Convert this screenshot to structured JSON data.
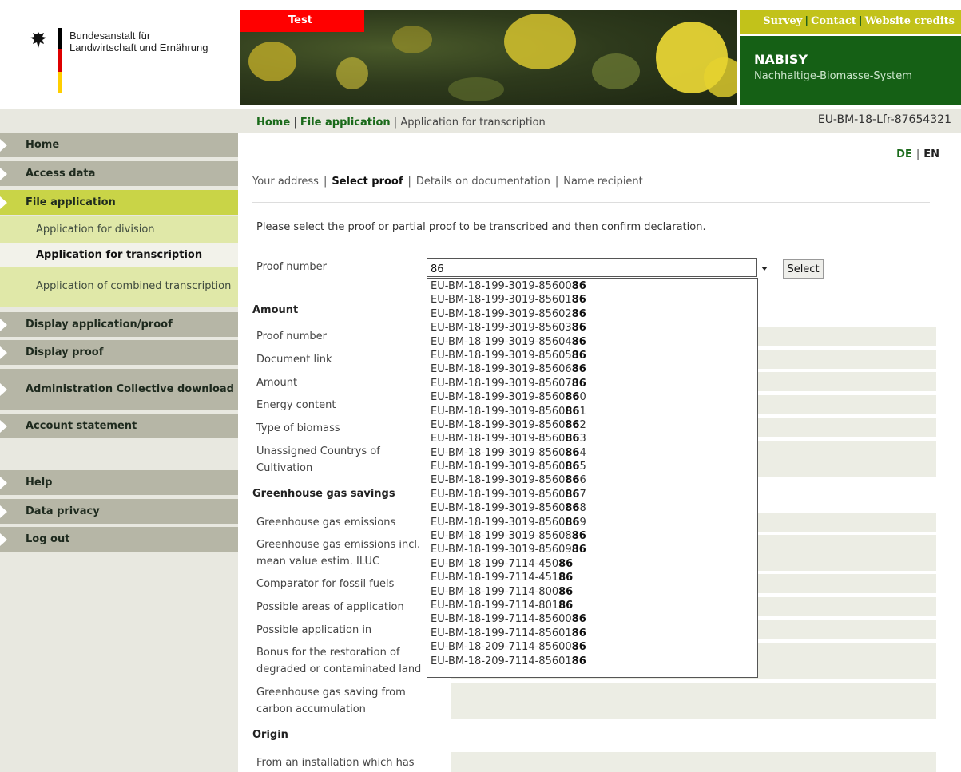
{
  "header": {
    "agency_line1": "Bundesanstalt für",
    "agency_line2": "Landwirtschaft und Ernährung",
    "test_label": "Test",
    "service_links": [
      "Survey",
      "Contact",
      "Website credits"
    ],
    "app_name": "NABISY",
    "app_subtitle": "Nachhaltige-Biomasse-System",
    "colors": {
      "brand_green": "#156015",
      "service_yellow": "#c2c21a",
      "test_red": "#ff0000"
    }
  },
  "breadcrumb": {
    "home": "Home",
    "sep1": "|",
    "file_application": "File application",
    "sep2": "|",
    "current": "Application for transcription"
  },
  "application_number": "EU-BM-18-Lfr-87654321",
  "sidebar": {
    "home": "Home",
    "access_data": "Access data",
    "file_application": "File application",
    "sub_division": "Application for division",
    "sub_transcription": "Application for transcription",
    "sub_combined": "Application of combined transcription",
    "display_application_proof": "Display application/proof",
    "display_proof": "Display proof",
    "administration_download": "Administration Collective download",
    "account_statement": "Account statement",
    "help": "Help",
    "data_privacy": "Data privacy",
    "log_out": "Log out"
  },
  "lang": {
    "de": "DE",
    "sep": "|",
    "en": "EN"
  },
  "steps": {
    "your_address": "Your address",
    "select_proof": "Select proof",
    "details": "Details on documentation",
    "name_recipient": "Name recipient",
    "sep": "|"
  },
  "instruction": "Please select the proof or partial proof to be transcribed and then confirm declaration.",
  "proof_field": {
    "label": "Proof number",
    "value": "86",
    "select_button": "Select"
  },
  "suggestions": [
    {
      "prefix": "EU-BM-18-199-3019-85600",
      "match": "86"
    },
    {
      "prefix": "EU-BM-18-199-3019-85601",
      "match": "86"
    },
    {
      "prefix": "EU-BM-18-199-3019-85602",
      "match": "86"
    },
    {
      "prefix": "EU-BM-18-199-3019-85603",
      "match": "86"
    },
    {
      "prefix": "EU-BM-18-199-3019-85604",
      "match": "86"
    },
    {
      "prefix": "EU-BM-18-199-3019-85605",
      "match": "86"
    },
    {
      "prefix": "EU-BM-18-199-3019-85606",
      "match": "86"
    },
    {
      "prefix": "EU-BM-18-199-3019-85607",
      "match": "86"
    },
    {
      "prefix": "EU-BM-18-199-3019-8560",
      "match": "86",
      "suffix": "0"
    },
    {
      "prefix": "EU-BM-18-199-3019-8560",
      "match": "86",
      "suffix": "1"
    },
    {
      "prefix": "EU-BM-18-199-3019-8560",
      "match": "86",
      "suffix": "2"
    },
    {
      "prefix": "EU-BM-18-199-3019-8560",
      "match": "86",
      "suffix": "3"
    },
    {
      "prefix": "EU-BM-18-199-3019-8560",
      "match": "86",
      "suffix": "4"
    },
    {
      "prefix": "EU-BM-18-199-3019-8560",
      "match": "86",
      "suffix": "5"
    },
    {
      "prefix": "EU-BM-18-199-3019-8560",
      "match": "86",
      "suffix": "6"
    },
    {
      "prefix": "EU-BM-18-199-3019-8560",
      "match": "86",
      "suffix": "7"
    },
    {
      "prefix": "EU-BM-18-199-3019-8560",
      "match": "86",
      "suffix": "8"
    },
    {
      "prefix": "EU-BM-18-199-3019-8560",
      "match": "86",
      "suffix": "9"
    },
    {
      "prefix": "EU-BM-18-199-3019-85608",
      "match": "86"
    },
    {
      "prefix": "EU-BM-18-199-3019-85609",
      "match": "86"
    },
    {
      "prefix": "EU-BM-18-199-7114-450",
      "match": "86"
    },
    {
      "prefix": "EU-BM-18-199-7114-451",
      "match": "86"
    },
    {
      "prefix": "EU-BM-18-199-7114-800",
      "match": "86"
    },
    {
      "prefix": "EU-BM-18-199-7114-801",
      "match": "86"
    },
    {
      "prefix": "EU-BM-18-199-7114-85600",
      "match": "86"
    },
    {
      "prefix": "EU-BM-18-199-7114-85601",
      "match": "86"
    },
    {
      "prefix": "EU-BM-18-209-7114-85600",
      "match": "86"
    },
    {
      "prefix": "EU-BM-18-209-7114-85601",
      "match": "86"
    }
  ],
  "sections": {
    "amount": "Amount",
    "ghg": "Greenhouse gas savings",
    "origin": "Origin"
  },
  "fields": {
    "proof_number": "Proof number",
    "document_link": "Document link",
    "amount": "Amount",
    "energy_content": "Energy content",
    "type_of_biomass": "Type of biomass",
    "unassigned_countries": "Unassigned Countrys of Cultivation",
    "ghg_emissions": "Greenhouse gas emissions",
    "ghg_emissions_iluc": "Greenhouse gas emissions incl. mean value estim. ILUC",
    "comparator": "Comparator for fossil fuels",
    "areas_of_application": "Possible areas of application",
    "application_in": "Possible application in",
    "bonus_restoration": "Bonus for the restoration of degraded or contaminated land",
    "carbon_accumulation": "Greenhouse gas saving from carbon accumulation",
    "from_installation": "From an installation which has"
  }
}
